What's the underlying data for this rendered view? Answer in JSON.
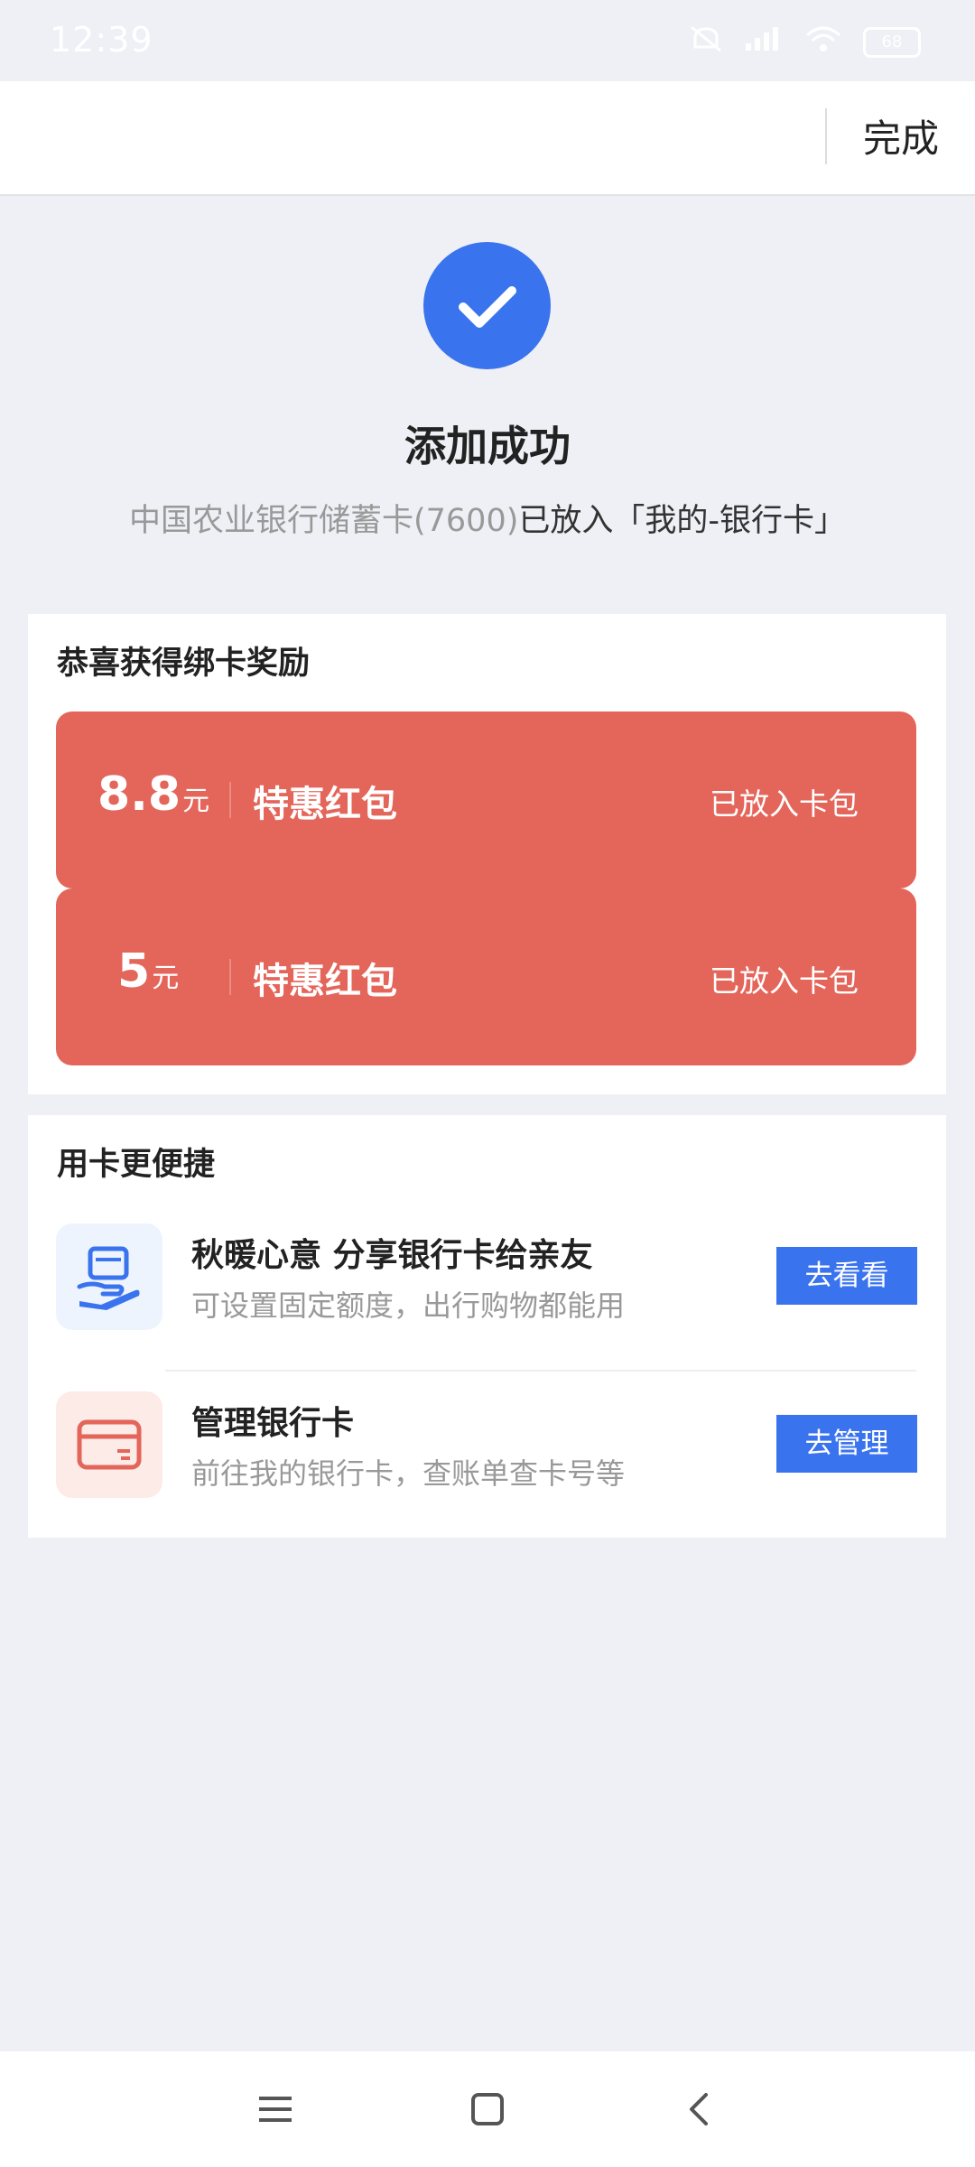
{
  "status_bar": {
    "time": "12:39",
    "battery": "68"
  },
  "header": {
    "done_label": "完成"
  },
  "success": {
    "title": "添加成功",
    "desc_prefix": "中国农业银行储蓄卡(7600)",
    "desc_suffix": "已放入「我的-银行卡」"
  },
  "rewards": {
    "title": "恭喜获得绑卡奖励",
    "coupons": [
      {
        "amount": "8.8",
        "unit": "元",
        "name": "特惠红包",
        "status": "已放入卡包"
      },
      {
        "amount": "5",
        "unit": "元",
        "name": "特惠红包",
        "status": "已放入卡包"
      }
    ]
  },
  "usage": {
    "title": "用卡更便捷",
    "items": [
      {
        "title": "秋暖心意 分享银行卡给亲友",
        "subtitle": "可设置固定额度，出行购物都能用",
        "button": "去看看",
        "icon": "hand-card-icon"
      },
      {
        "title": "管理银行卡",
        "subtitle": "前往我的银行卡，查账单查卡号等",
        "button": "去管理",
        "icon": "bank-card-icon"
      }
    ]
  },
  "colors": {
    "accent": "#3a73ee",
    "coupon_red": "#e4655a",
    "background": "#eff0f5"
  }
}
